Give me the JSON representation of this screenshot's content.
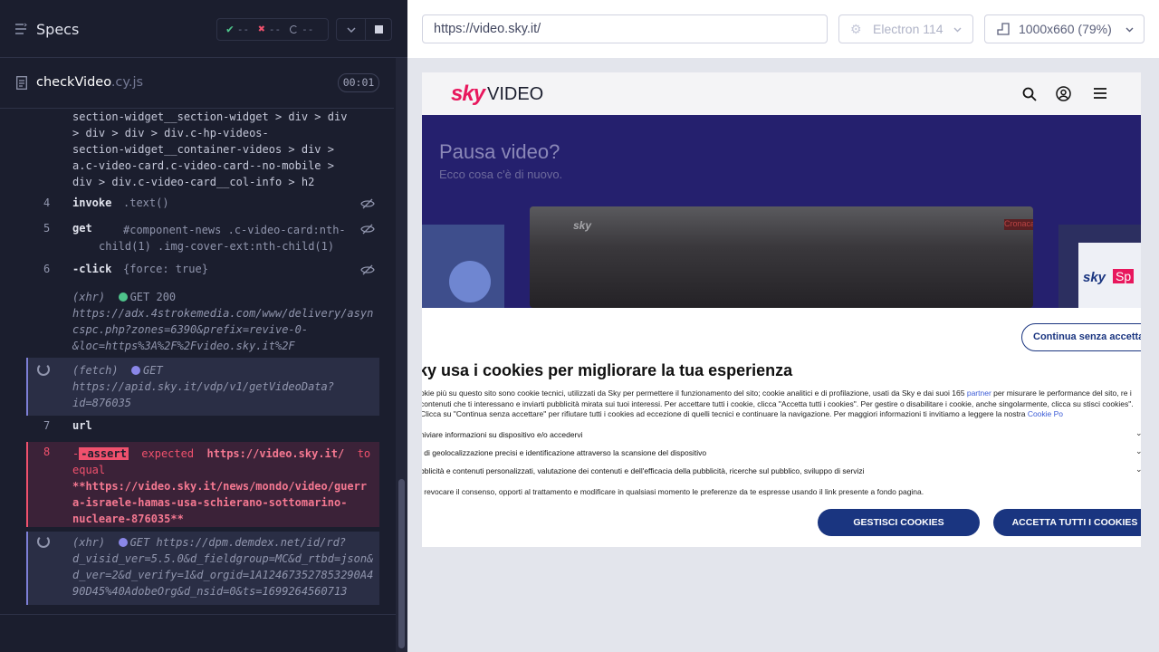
{
  "reporter": {
    "title": "Specs",
    "stats": {
      "passed": "--",
      "failed": "--",
      "pending": "--"
    },
    "file": {
      "name": "checkVideo",
      "ext": ".cy.js",
      "duration": "00:01"
    },
    "commands": [
      {
        "selector_lines": [
          "section-widget__section-widget > div > div",
          "> div > div > div.c-hp-videos-",
          "section-widget__container-videos > div >",
          "a.c-video-card.c-video-card--no-mobile >",
          "div > div.c-video-card__col-info > h2"
        ]
      },
      {
        "num": "4",
        "name": "invoke",
        "msg": ".text()"
      },
      {
        "num": "5",
        "name": "get",
        "msg_lines": [
          "#component-news .c-video-card:nth-",
          "child(1) .img-cover-ext:nth-child(1)"
        ]
      },
      {
        "num": "6",
        "name": "-click",
        "msg": "{force: true}"
      },
      {
        "type": "(xhr)",
        "status": "GET 200",
        "url_lines": [
          "https://adx.4strokemedia.com/www/delivery/asyn",
          "cspc.php?zones=6390&prefix=revive-0-",
          "&loc=https%3A%2F%2Fvideo.sky.it%2F"
        ]
      },
      {
        "type": "(fetch)",
        "status": "GET",
        "url_lines": [
          "https://apid.sky.it/vdp/v1/getVideoData?",
          "id=876035"
        ]
      },
      {
        "num": "7",
        "name": "url"
      },
      {
        "num": "8",
        "name": "-assert",
        "msg_prefix": "expected",
        "expected": "https://video.sky.it/",
        "msg_mid": "to",
        "msg_mid2": "equal",
        "actual_lines": [
          "**https://video.sky.it/news/mondo/video/guerr",
          "a-israele-hamas-usa-schierano-sottomarino-",
          "nucleare-876035**"
        ]
      },
      {
        "type": "(xhr)",
        "status": "GET",
        "url_lines": [
          "https://dpm.demdex.net/id/rd?",
          "d_visid_ver=5.5.0&d_fieldgroup=MC&d_rtbd=json&",
          "d_ver=2&d_verify=1&d_orgid=1A124673527853290A4",
          "90D45%40AdobeOrg&d_nsid=0&ts=1699264560713"
        ]
      }
    ]
  },
  "browser_bar": {
    "url": "https://video.sky.it/",
    "browser": "Electron 114",
    "viewport": "1000x660",
    "scale": "(79%)"
  },
  "site": {
    "logo": "sky",
    "logo_suffix": "VIDEO",
    "hero_title": "Pausa video?",
    "hero_subtitle": "Ecco cosa c'è di nuovo.",
    "card_brand": "sky",
    "card_tag": "Cronaca",
    "card_right_brand": "sky",
    "card_right_tag": "Sp",
    "cookie": {
      "continue_label": "Continua senza accettare",
      "title": "ky usa i cookies per migliorare la tua esperienza",
      "text_1": "okie più su questo sito sono cookie tecnici, utilizzati da Sky per permettere il funzionamento del sito; cookie analitici e di profilazione, usati da Sky e dai suoi 165 ",
      "partner_link": "partner",
      "text_2": " per misurare le performance del sito, re i contenuti che ti interessano e inviarti pubblicità mirata sui tuoi interessi. Per accettare tutti i cookie, clicca \"Accetta tutti i cookies\". Per gestire o disabilitare i cookie, anche singolarmente, clicca su stisci cookies\". Clicca su \"Continua senza accettare\" per rifiutare tutti i cookies ad eccezione di quelli tecnici e continuare la navigazione. Per maggiori informazioni ti invitiamo a leggere la nostra ",
      "policy_link": "Cookie Po",
      "purposes": [
        "niviare informazioni su dispositivo e/o accedervi",
        "i di geolocalizzazione precisi e identificazione attraverso la scansione del dispositivo",
        "bblicità e contenuti personalizzati, valutazione dei contenuti e dell'efficacia della pubblicità, ricerche sul pubblico, sviluppo di servizi"
      ],
      "note": "i revocare il consenso, opporti al trattamento e modificare in qualsiasi momento le preferenze da te espresse usando il link presente a fondo pagina.",
      "manage_label": "GESTISCI COOKIES",
      "accept_label": "ACCETTA TUTTI I COOKIES"
    }
  },
  "colors": {
    "reporter_bg": "#1b1e2e",
    "failed_bg": "#3b2238",
    "assert_red": "#f0516d",
    "sky_blue": "#1a3580",
    "hero_bg": "#25206e"
  }
}
